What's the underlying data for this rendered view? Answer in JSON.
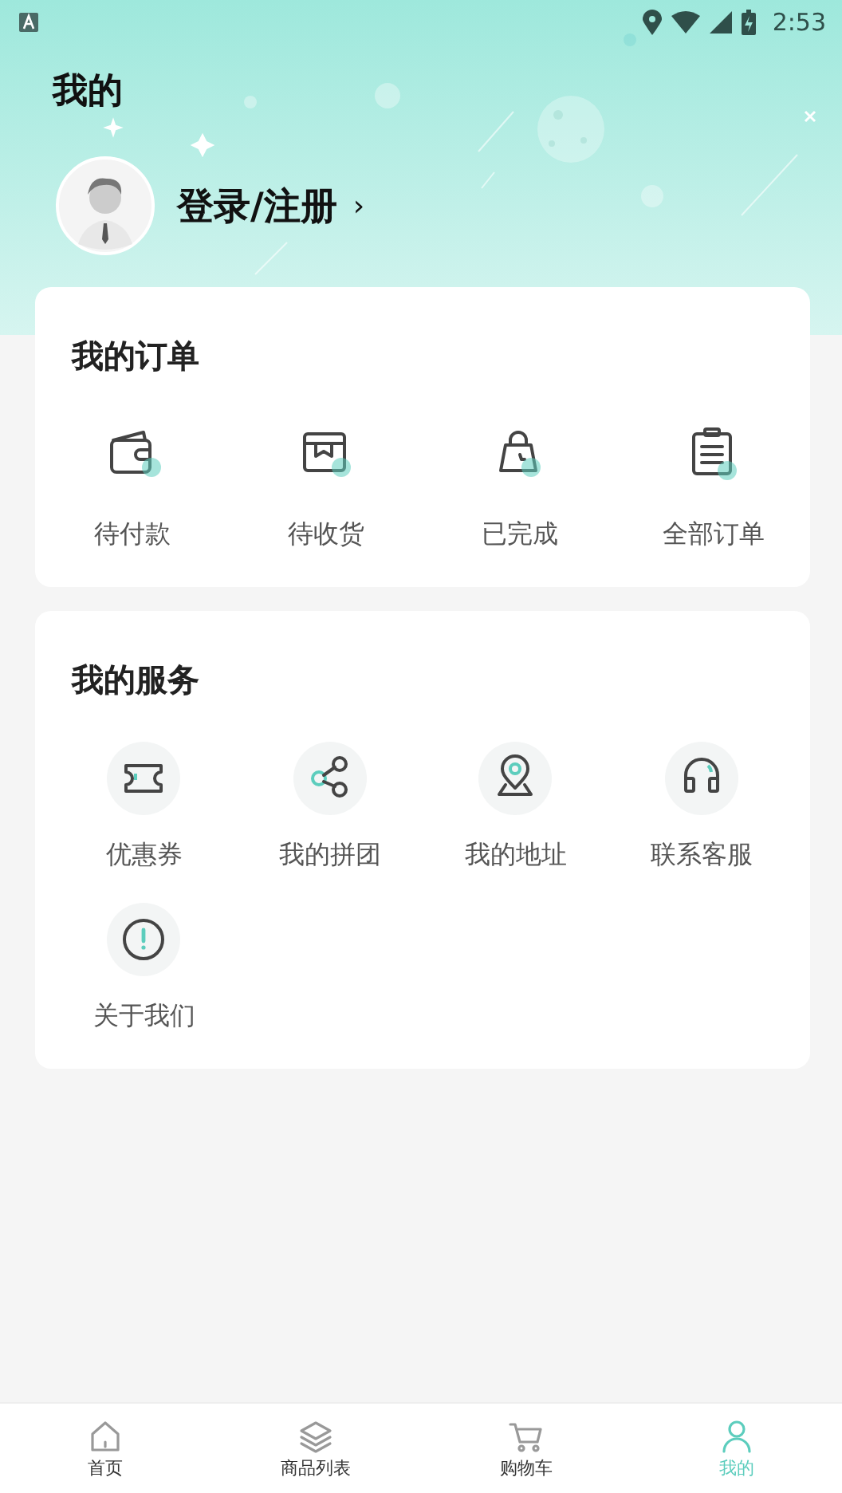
{
  "status_bar": {
    "time": "2:53"
  },
  "header": {
    "title": "我的",
    "login": "登录/注册",
    "chevron": "›"
  },
  "orders": {
    "title": "我的订单",
    "items": [
      {
        "label": "待付款",
        "kind": "wallet"
      },
      {
        "label": "待收货",
        "kind": "box"
      },
      {
        "label": "已完成",
        "kind": "bag"
      },
      {
        "label": "全部订单",
        "kind": "clipboard"
      }
    ]
  },
  "services": {
    "title": "我的服务",
    "items": [
      {
        "label": "优惠券",
        "kind": "ticket"
      },
      {
        "label": "我的拼团",
        "kind": "share"
      },
      {
        "label": "我的地址",
        "kind": "pin"
      },
      {
        "label": "联系客服",
        "kind": "headset"
      },
      {
        "label": "关于我们",
        "kind": "info"
      }
    ]
  },
  "tab_bar": [
    {
      "label": "首页",
      "kind": "home",
      "selected": false
    },
    {
      "label": "商品列表",
      "kind": "layers",
      "selected": false
    },
    {
      "label": "购物车",
      "kind": "cart",
      "selected": false
    },
    {
      "label": "我的",
      "kind": "user",
      "selected": true
    }
  ]
}
